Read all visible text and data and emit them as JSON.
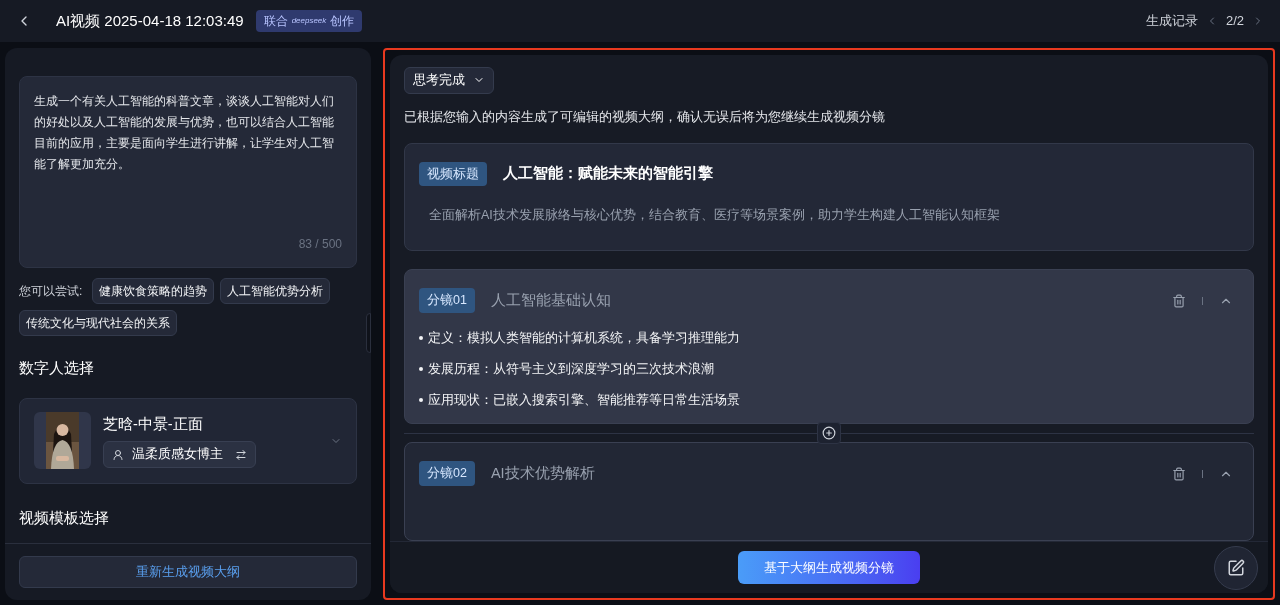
{
  "header": {
    "title": "AI视频 2025-04-18 12:03:49",
    "badge_prefix": "联合",
    "badge_brand": "deepseek",
    "badge_suffix": "创作",
    "history_label": "生成记录",
    "page": "2/2"
  },
  "left": {
    "description": "生成一个有关人工智能的科普文章，谈谈人工智能对人们的好处以及人工智能的发展与优势，也可以结合人工智能目前的应用，主要是面向学生进行讲解，让学生对人工智能了解更加充分。",
    "counter": "83 / 500",
    "try_label": "您可以尝试:",
    "suggestions": [
      "健康饮食策略的趋势",
      "人工智能优势分析",
      "传统文化与现代社会的关系"
    ],
    "avatar_heading": "数字人选择",
    "avatar": {
      "name": "芝晗-中景-正面",
      "voice": "温柔质感女博主"
    },
    "template_heading": "视频模板选择",
    "regenerate_button": "重新生成视频大纲"
  },
  "right": {
    "status": "思考完成",
    "intro": "已根据您输入的内容生成了可编辑的视频大纲，确认无误后将为您继续生成视频分镜",
    "title_card": {
      "tag": "视频标题",
      "title": "人工智能：赋能未来的智能引擎",
      "summary": "全面解析AI技术发展脉络与核心优势，结合教育、医疗等场景案例，助力学生构建人工智能认知框架"
    },
    "scenes": [
      {
        "tag": "分镜01",
        "title": "人工智能基础认知",
        "expanded": true,
        "bullets": [
          "定义：模拟人类智能的计算机系统，具备学习推理能力",
          "发展历程：从符号主义到深度学习的三次技术浪潮",
          "应用现状：已嵌入搜索引擎、智能推荐等日常生活场景"
        ]
      },
      {
        "tag": "分镜02",
        "title": "AI技术优势解析",
        "expanded": true
      }
    ],
    "generate_button": "基于大纲生成视频分镜"
  }
}
